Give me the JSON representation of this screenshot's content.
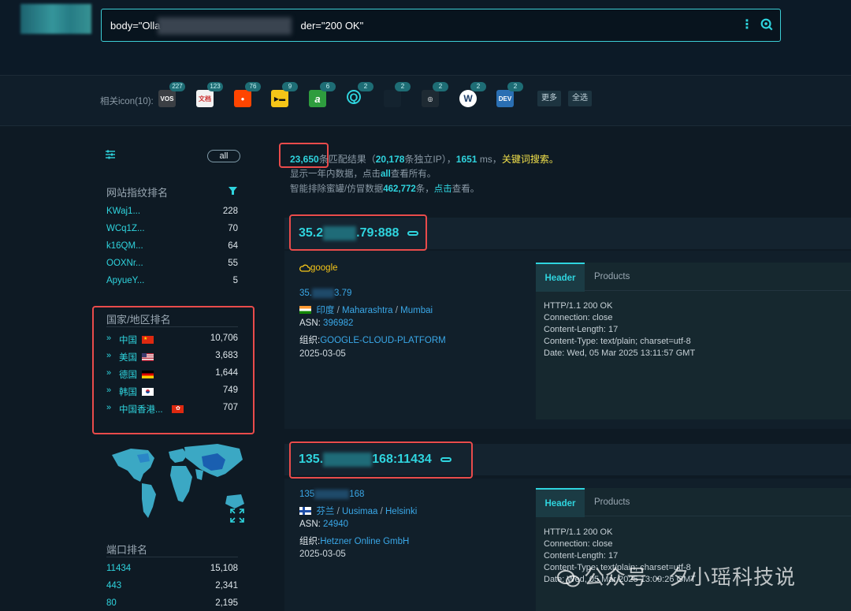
{
  "search": {
    "query_start": "body=\"Olla",
    "query_end": "der=\"200 OK\""
  },
  "icon_bar": {
    "label": "相关icon(10):",
    "icons": [
      {
        "name": "vos",
        "text": "VOS",
        "bg": "#3b3f44",
        "count": "227"
      },
      {
        "name": "doc",
        "text": "文档",
        "bg": "#f2f2f2",
        "count": "123"
      },
      {
        "name": "reddit",
        "text": "●",
        "bg": "#ff4500",
        "count": "76"
      },
      {
        "name": "yellow",
        "text": "▶▬",
        "bg": "#f5c518",
        "count": "9"
      },
      {
        "name": "green-a",
        "text": "a",
        "bg": "#2e9d3e",
        "count": "6"
      },
      {
        "name": "q",
        "text": "Q",
        "bg": "#0e1a24",
        "count": "2"
      },
      {
        "name": "blank",
        "text": "",
        "bg": "#14232f",
        "count": "2"
      },
      {
        "name": "ollama",
        "text": "◎",
        "bg": "#1e2a33",
        "count": "2"
      },
      {
        "name": "wordpress",
        "text": "W",
        "bg": "#1c3d68",
        "count": "2"
      },
      {
        "name": "dev",
        "text": "DEV",
        "bg": "#2a6fb3",
        "count": "2"
      }
    ],
    "more": "更多",
    "select_all": "全选"
  },
  "sidebar": {
    "all": "all",
    "fingerprint": {
      "title": "网站指纹排名",
      "items": [
        {
          "k": "KWaj1...",
          "v": "228"
        },
        {
          "k": "WCq1Z...",
          "v": "70"
        },
        {
          "k": "k16QM...",
          "v": "64"
        },
        {
          "k": "OOXNr...",
          "v": "55"
        },
        {
          "k": "ApyueY...",
          "v": "5"
        }
      ]
    },
    "country": {
      "title": "国家/地区排名",
      "items": [
        {
          "k": "中国",
          "v": "10,706"
        },
        {
          "k": "美国",
          "v": "3,683"
        },
        {
          "k": "德国",
          "v": "1,644"
        },
        {
          "k": "韩国",
          "v": "749"
        },
        {
          "k": "中国香港...",
          "v": "707"
        }
      ]
    },
    "ports": {
      "title": "端口排名",
      "items": [
        {
          "k": "11434",
          "v": "15,108"
        },
        {
          "k": "443",
          "v": "2,341"
        },
        {
          "k": "80",
          "v": "2,195"
        }
      ]
    }
  },
  "results": {
    "count": "23,650",
    "count_text": "条匹配结果（",
    "ips": "20,178",
    "ips_text": "条独立IP），",
    "ms": "1651",
    "ms_text": "ms，",
    "keyword": "关键词搜索。",
    "line2_a": "显示一年内数据，点击",
    "line2_all": "all",
    "line2_b": "查看所有。",
    "line3_a": "智能排除蜜罐/仿冒数据",
    "line3_num": "462,772",
    "line3_b": "条，",
    "line3_click": "点击",
    "line3_c": "查看。"
  },
  "cards": [
    {
      "ip_start": "35.2",
      "ip_end": ".79:888",
      "provider": "google",
      "ip_small_start": "35.",
      "ip_small_end": "3.79",
      "country": "印度",
      "region": "Maharashtra",
      "city": "Mumbai",
      "asn_label": "ASN:",
      "asn": "396982",
      "org_label": "组织:",
      "org": "GOOGLE-CLOUD-PLATFORM",
      "date": "2025-03-05",
      "tab_header": "Header",
      "tab_products": "Products",
      "header": "HTTP/1.1 200 OK\nConnection: close\nContent-Length: 17\nContent-Type: text/plain; charset=utf-8\nDate: Wed, 05 Mar 2025 13:11:57 GMT"
    },
    {
      "ip_start": "135.",
      "ip_end": "168:11434",
      "ip_small_start": "135",
      "ip_small_end": "168",
      "country": "芬兰",
      "region": "Uusimaa",
      "city": "Helsinki",
      "asn_label": "ASN:",
      "asn": "24940",
      "org_label": "组织:",
      "org": "Hetzner Online GmbH",
      "date": "2025-03-05",
      "tab_header": "Header",
      "tab_products": "Products",
      "header": "HTTP/1.1 200 OK\nConnection: close\nContent-Length: 17\nContent-Type: text/plain; charset=utf-8\nDate: Wed, 05 Mar 2025 13:09:26 GMT"
    }
  ],
  "watermark": "公众号 · 夕小瑶科技说"
}
